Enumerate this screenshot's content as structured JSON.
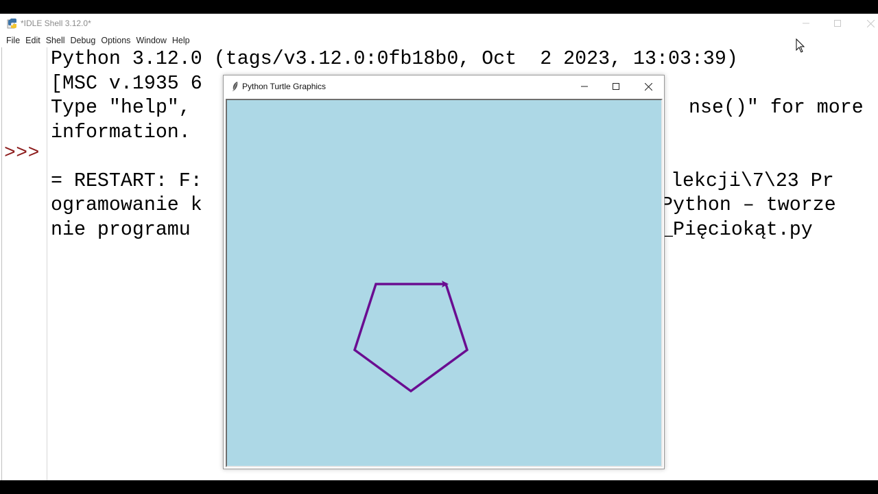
{
  "idle": {
    "title": "*IDLE Shell 3.12.0*",
    "menu": [
      "File",
      "Edit",
      "Shell",
      "Debug",
      "Options",
      "Window",
      "Help"
    ],
    "prompt": ">>>",
    "lines": {
      "l1": "Python 3.12.0 (tags/v3.12.0:0fb18b0, Oct  2 2023, 13:03:39)",
      "l2": "[MSC v.1935 6",
      "l3a": "Type \"help\",",
      "l3b": "nse()\" for more",
      "l4": "information.",
      "l5a": "= RESTART: F:",
      "l5b": "lekcji\\7\\23 Pr",
      "l6a": "ogramowanie k",
      "l6b": "Python – tworze",
      "l7a": "nie programu",
      "l7b": "_Pięciokąt.py"
    }
  },
  "turtle": {
    "title": "Python Turtle Graphics",
    "canvas_color": "#add8e6",
    "pen_color": "#6a0d91",
    "shape": "pentagon",
    "sides": 5,
    "heading_deg": 0
  },
  "colors": {
    "prompt": "#8b1a1a",
    "text": "#000000"
  }
}
